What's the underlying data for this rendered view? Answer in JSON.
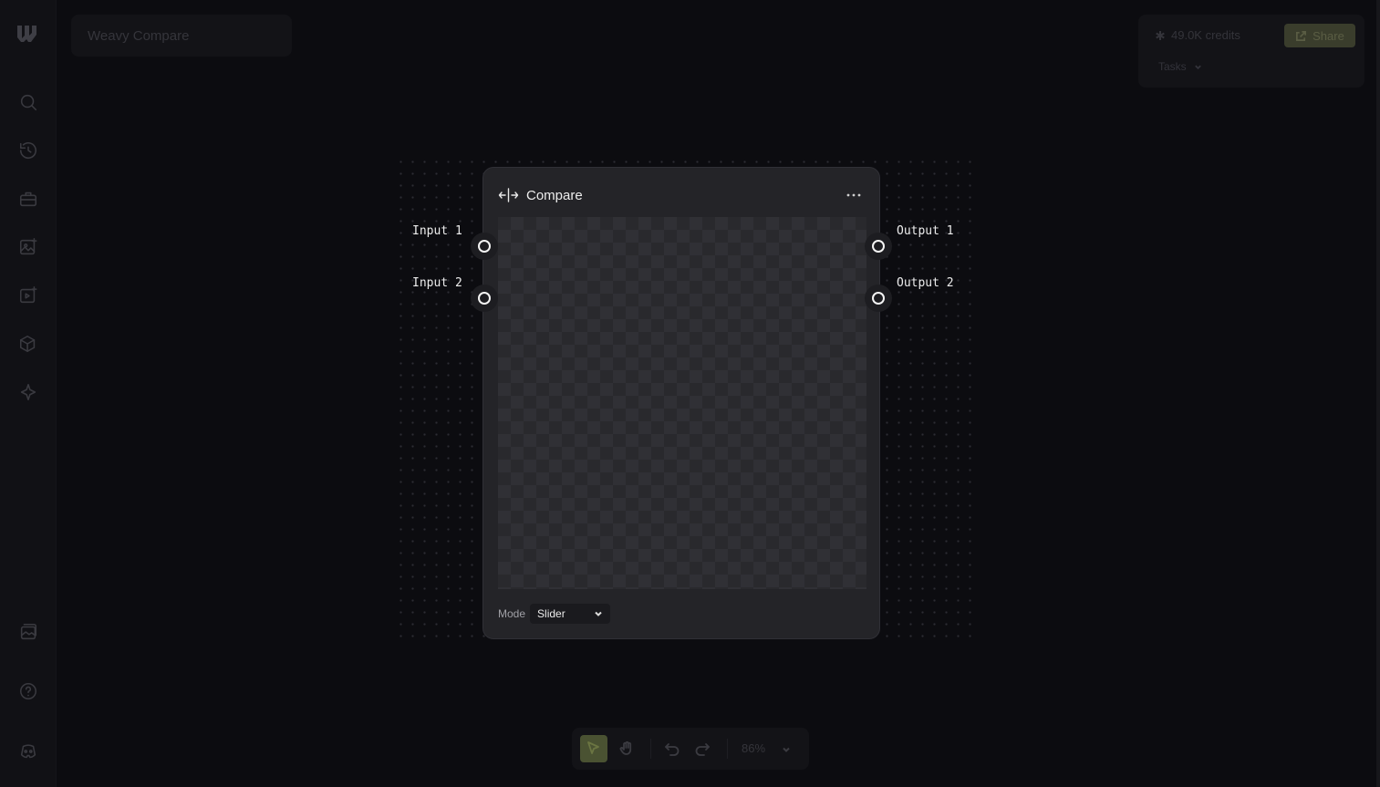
{
  "project": {
    "title": "Weavy Compare"
  },
  "header": {
    "credits": "49.0K credits",
    "share_label": "Share",
    "tasks_label": "Tasks"
  },
  "sidebar": {
    "icons": [
      "logo-icon",
      "search-icon",
      "history-icon",
      "toolbox-icon",
      "image-icon",
      "video-icon",
      "3d-icon",
      "sparkle-icon",
      "gallery-icon",
      "help-icon",
      "discord-icon"
    ]
  },
  "node": {
    "title": "Compare",
    "inputs": [
      "Input 1",
      "Input 2"
    ],
    "outputs": [
      "Output 1",
      "Output 2"
    ],
    "mode_label": "Mode",
    "mode_value": "Slider"
  },
  "toolbar": {
    "zoom": "86%"
  },
  "colors": {
    "background": "#0c0c10",
    "node": "#242428",
    "accent": "#4a5232"
  }
}
